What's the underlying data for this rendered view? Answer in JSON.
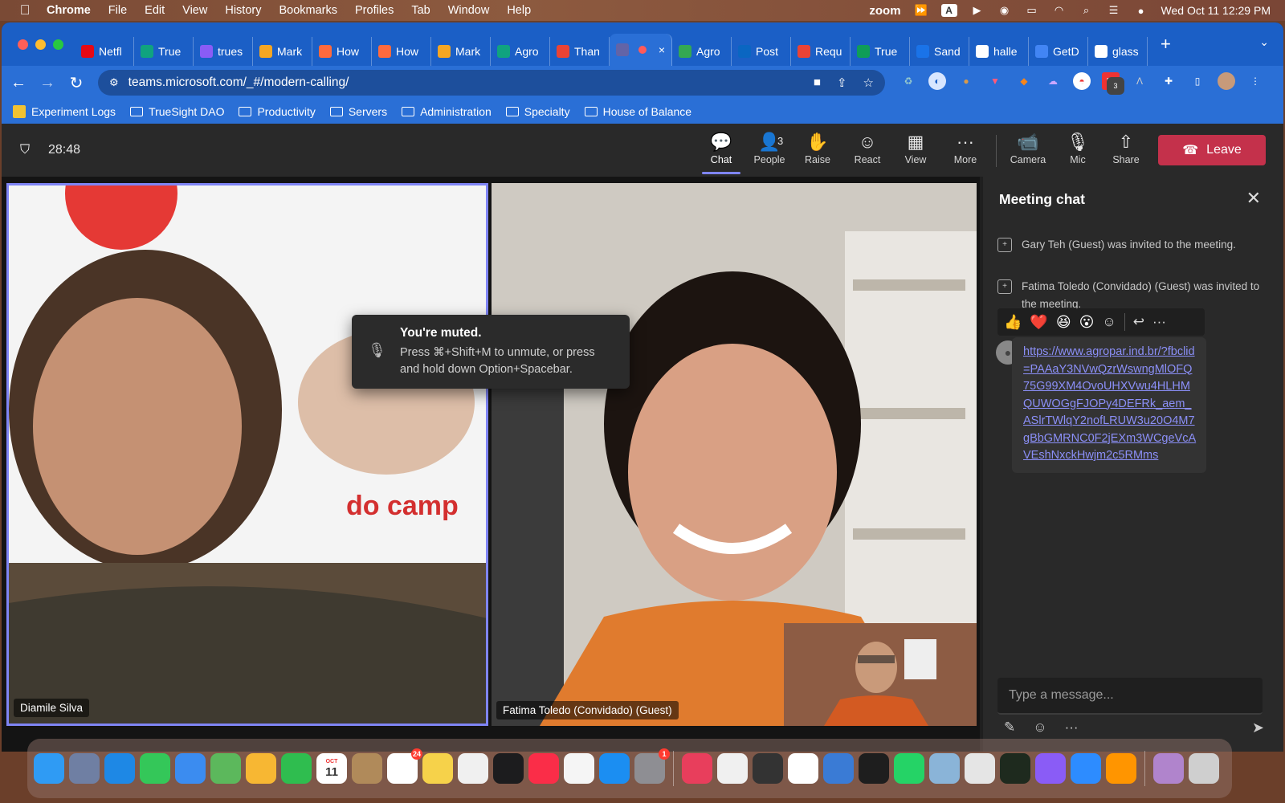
{
  "menubar": {
    "app": "Chrome",
    "items": [
      "File",
      "Edit",
      "View",
      "History",
      "Bookmarks",
      "Profiles",
      "Tab",
      "Window",
      "Help"
    ],
    "right_text": "zoom",
    "datetime": "Wed Oct 11  12:29 PM"
  },
  "browser": {
    "tabs": [
      {
        "label": "Netfl",
        "icon": "netflix-icon",
        "color": "#e50914"
      },
      {
        "label": "True",
        "icon": "openai-icon",
        "color": "#10a37f"
      },
      {
        "label": "trues",
        "icon": "app-icon",
        "color": "#8a5cf6"
      },
      {
        "label": "Mark",
        "icon": "diamond-icon",
        "color": "#f5a623"
      },
      {
        "label": "How",
        "icon": "app-icon",
        "color": "#ff6a3d"
      },
      {
        "label": "How",
        "icon": "app-icon",
        "color": "#ff6a3d"
      },
      {
        "label": "Mark",
        "icon": "diamond-icon",
        "color": "#f5a623"
      },
      {
        "label": "Agro",
        "icon": "openai-icon",
        "color": "#10a37f"
      },
      {
        "label": "Than",
        "icon": "gmail-icon",
        "color": "#ea4335"
      },
      {
        "label": "",
        "icon": "teams-icon",
        "color": "#6264a7",
        "active": true
      },
      {
        "label": "Agro",
        "icon": "app-icon",
        "color": "#34a853"
      },
      {
        "label": "Post",
        "icon": "linkedin-icon",
        "color": "#0a66c2"
      },
      {
        "label": "Requ",
        "icon": "gmail-icon",
        "color": "#ea4335"
      },
      {
        "label": "True",
        "icon": "sheets-icon",
        "color": "#0f9d58"
      },
      {
        "label": "Sand",
        "icon": "app-icon",
        "color": "#1a73e8"
      },
      {
        "label": "halle",
        "icon": "google-icon",
        "color": "#ffffff"
      },
      {
        "label": "GetD",
        "icon": "calendar-icon",
        "color": "#4285f4"
      },
      {
        "label": "glass",
        "icon": "google-icon",
        "color": "#ffffff"
      }
    ],
    "tab_close": "×",
    "new_tab": "+",
    "url": "teams.microsoft.com/_#/modern-calling/",
    "bookmarks": [
      "Experiment Logs",
      "TrueSight DAO",
      "Productivity",
      "Servers",
      "Administration",
      "Specialty",
      "House of Balance"
    ],
    "ext_badge": "3"
  },
  "teams": {
    "timer": "28:48",
    "toolbar": [
      {
        "label": "Chat",
        "icon": "chat-icon",
        "glyph": "💬",
        "active": true
      },
      {
        "label": "People",
        "icon": "people-icon",
        "glyph": "👤",
        "count": "3"
      },
      {
        "label": "Raise",
        "icon": "raise-hand-icon",
        "glyph": "✋"
      },
      {
        "label": "React",
        "icon": "react-icon",
        "glyph": "☺"
      },
      {
        "label": "View",
        "icon": "view-icon",
        "glyph": "▦"
      },
      {
        "label": "More",
        "icon": "more-icon",
        "glyph": "···"
      },
      {
        "label": "Camera",
        "icon": "camera-icon",
        "glyph": "📹"
      },
      {
        "label": "Mic",
        "icon": "mic-off-icon",
        "glyph": "🎙"
      },
      {
        "label": "Share",
        "icon": "share-icon",
        "glyph": "⇧"
      }
    ],
    "leave_label": "Leave",
    "participants": {
      "main": "Diamile Silva",
      "second": "Fatima Toledo (Convidado) (Guest)"
    },
    "toast": {
      "title": "You're muted.",
      "body": "Press ⌘+Shift+M to unmute, or press and hold down Option+Spacebar."
    },
    "chat": {
      "title": "Meeting chat",
      "system_messages": [
        "Gary Teh (Guest) was invited to the meeting.",
        "Fatima Toledo (Convidado) (Guest) was invited to the meeting."
      ],
      "reactions": [
        "👍",
        "❤️",
        "😆",
        "😮"
      ],
      "message_link": "https://www.agropar.ind.br/?fbclid=PAAaY3NVwQzrWswngMlOFQ75G99XM4OvoUHXVwu4HLHMQUWOGgFJOPy4DEFRk_aem_ASlrTWlqY2nofLRUW3u20O4M7gBbGMRNC0F2jEXm3WCgeVcAVEshNxckHwjm2c5RMms",
      "composer_placeholder": "Type a message..."
    }
  },
  "dock": {
    "calendar_month": "OCT",
    "calendar_day": "11",
    "reminders_badge": "24",
    "settings_badge": "1",
    "apps": [
      {
        "name": "finder",
        "color": "#2f9bf4"
      },
      {
        "name": "launchpad",
        "color": "#6f7fa3"
      },
      {
        "name": "safari",
        "color": "#1e88e5"
      },
      {
        "name": "messages",
        "color": "#34c759"
      },
      {
        "name": "mail",
        "color": "#3b8cf0"
      },
      {
        "name": "maps",
        "color": "#5cb85c"
      },
      {
        "name": "photos",
        "color": "#f7b733"
      },
      {
        "name": "facetime",
        "color": "#2fbd4f"
      },
      {
        "name": "calendar",
        "color": "#ffffff"
      },
      {
        "name": "contacts",
        "color": "#b08a5a"
      },
      {
        "name": "reminders",
        "color": "#ffffff"
      },
      {
        "name": "notes",
        "color": "#f6d24a"
      },
      {
        "name": "freeform",
        "color": "#f0f0f0"
      },
      {
        "name": "apple-tv",
        "color": "#1c1c1e"
      },
      {
        "name": "music",
        "color": "#fa2d48"
      },
      {
        "name": "news",
        "color": "#f5f5f5"
      },
      {
        "name": "app-store",
        "color": "#1b8ef2"
      },
      {
        "name": "system-settings",
        "color": "#8e8e93"
      },
      {
        "name": "lips-app",
        "color": "#e83e5c"
      },
      {
        "name": "textedit",
        "color": "#f0f0f0"
      },
      {
        "name": "sublime-text",
        "color": "#333333"
      },
      {
        "name": "chrome",
        "color": "#ffffff"
      },
      {
        "name": "tableplus",
        "color": "#3a7bd5"
      },
      {
        "name": "terminal",
        "color": "#1e1e1e"
      },
      {
        "name": "whatsapp",
        "color": "#25d366"
      },
      {
        "name": "preview",
        "color": "#8ab4d8"
      },
      {
        "name": "printer",
        "color": "#e5e5e5"
      },
      {
        "name": "activity-monitor",
        "color": "#1e2a1e"
      },
      {
        "name": "messenger",
        "color": "#8a5cf6"
      },
      {
        "name": "zoom",
        "color": "#2d8cff"
      },
      {
        "name": "calculator",
        "color": "#ff9500"
      },
      {
        "name": "image-file",
        "color": "#b084cc"
      },
      {
        "name": "trash",
        "color": "#cfcfcf"
      }
    ]
  }
}
